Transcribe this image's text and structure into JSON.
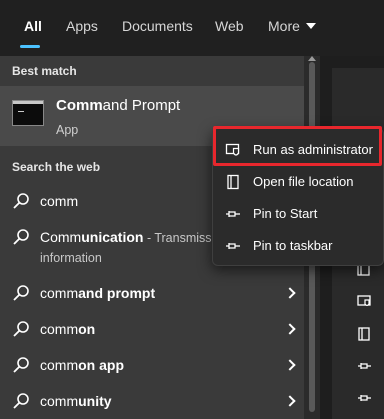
{
  "tabs": [
    {
      "label": "All",
      "active": true
    },
    {
      "label": "Apps"
    },
    {
      "label": "Documents"
    },
    {
      "label": "Web"
    },
    {
      "label": "More"
    }
  ],
  "best_match": {
    "heading": "Best match",
    "title_bold": "Comm",
    "title_rest": "and Prompt",
    "subtitle": "App"
  },
  "web": {
    "heading": "Search the web",
    "items": [
      {
        "plain": "comm",
        "bold": "",
        "sub": "",
        "line2": "",
        "chevron": false
      },
      {
        "plain": "Comm",
        "bold": "unication",
        "sub": " - Transmiss",
        "line2": "information",
        "chevron": false
      },
      {
        "plain": "comm",
        "bold": "and prompt",
        "sub": "",
        "line2": "",
        "chevron": true
      },
      {
        "plain": "comm",
        "bold": "on",
        "sub": "",
        "line2": "",
        "chevron": true
      },
      {
        "plain": "comm",
        "bold": "on app",
        "sub": "",
        "line2": "",
        "chevron": true
      },
      {
        "plain": "comm",
        "bold": "unity",
        "sub": "",
        "line2": "",
        "chevron": true
      }
    ]
  },
  "context_menu": {
    "items": [
      {
        "label": "Run as administrator",
        "icon": "shield-icon",
        "highlighted": true
      },
      {
        "label": "Open file location",
        "icon": "folder-icon"
      },
      {
        "label": "Pin to Start",
        "icon": "pin-icon"
      },
      {
        "label": "Pin to taskbar",
        "icon": "pin-icon"
      }
    ],
    "highlight_color": "#e8272d"
  },
  "colors": {
    "accent": "#4cc2ff",
    "panel": "#3a3a3a",
    "selected_row": "#4a4a4a"
  }
}
